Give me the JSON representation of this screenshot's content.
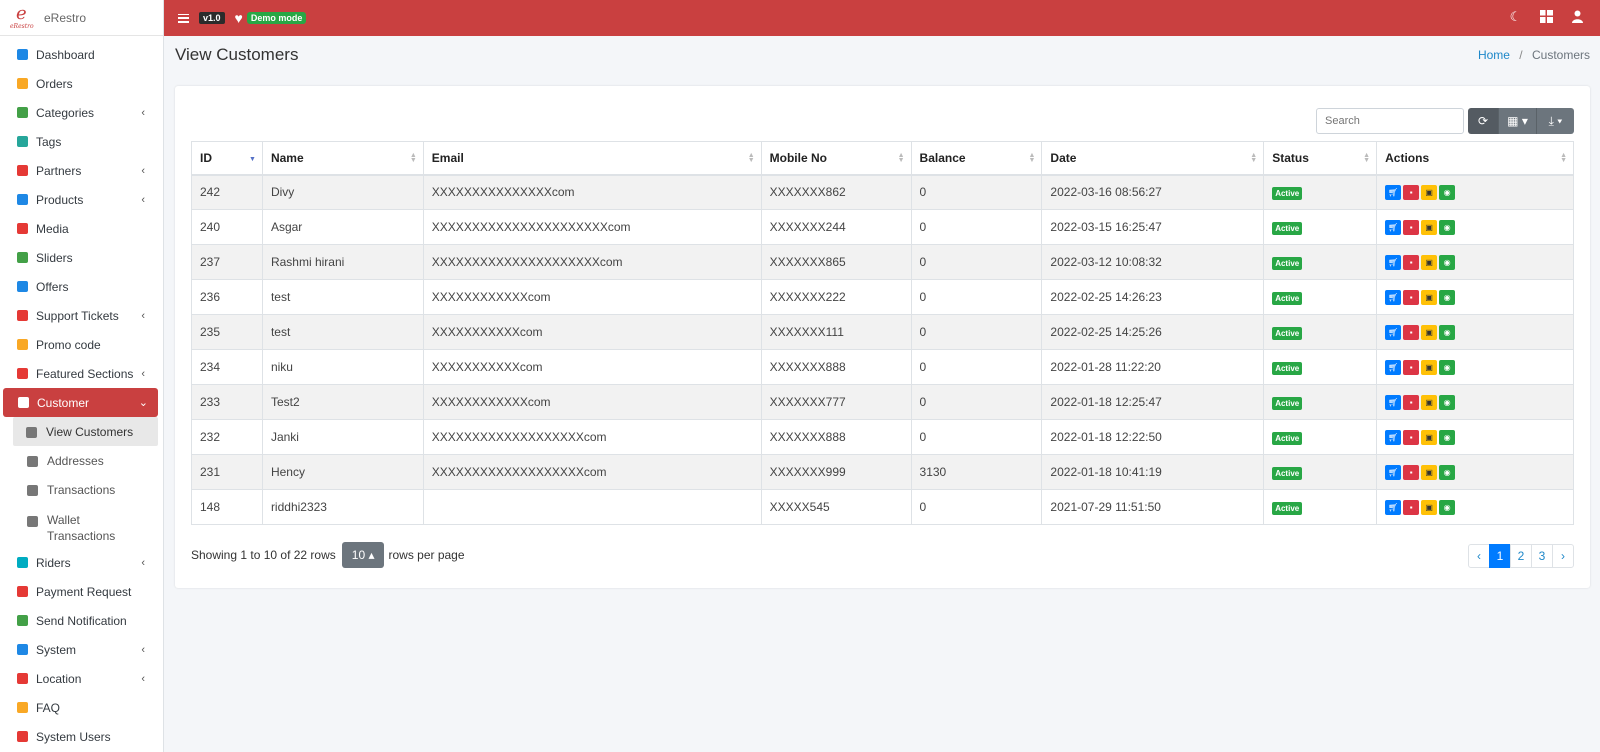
{
  "brand": {
    "name": "eRestro",
    "logo_letter": "e",
    "logo_sub": "eRestro"
  },
  "topbar": {
    "version": "v1.0",
    "demo_label": "Demo mode",
    "color": "#c94040"
  },
  "sidebar": {
    "items": [
      {
        "label": "Dashboard",
        "icon": "dashboard-icon",
        "color": "#1e88e5",
        "chevron": false
      },
      {
        "label": "Orders",
        "icon": "cart-icon",
        "color": "#f9a825",
        "chevron": false
      },
      {
        "label": "Categories",
        "icon": "target-icon",
        "color": "#43a047",
        "chevron": true
      },
      {
        "label": "Tags",
        "icon": "tag-icon",
        "color": "#26a69a",
        "chevron": false
      },
      {
        "label": "Partners",
        "icon": "store-icon",
        "color": "#e53935",
        "chevron": true
      },
      {
        "label": "Products",
        "icon": "cubes-icon",
        "color": "#1e88e5",
        "chevron": true
      },
      {
        "label": "Media",
        "icon": "media-icon",
        "color": "#e53935",
        "chevron": false
      },
      {
        "label": "Sliders",
        "icon": "image-icon",
        "color": "#43a047",
        "chevron": false
      },
      {
        "label": "Offers",
        "icon": "gift-icon",
        "color": "#1e88e5",
        "chevron": false
      },
      {
        "label": "Support Tickets",
        "icon": "ticket-icon",
        "color": "#e53935",
        "chevron": true
      },
      {
        "label": "Promo code",
        "icon": "puzzle-icon",
        "color": "#f9a825",
        "chevron": false
      },
      {
        "label": "Featured Sections",
        "icon": "layers-icon",
        "color": "#e53935",
        "chevron": true
      },
      {
        "label": "Customer",
        "icon": "user-icon",
        "color": "#ffffff",
        "chevron": true,
        "active": true
      }
    ],
    "customer_sub": [
      {
        "label": "View Customers",
        "icon": "users-icon",
        "active": true
      },
      {
        "label": "Addresses",
        "icon": "address-icon"
      },
      {
        "label": "Transactions",
        "icon": "money-icon"
      },
      {
        "label": "Wallet",
        "label2": "Transactions",
        "icon": "wallet-icon"
      }
    ],
    "items_after": [
      {
        "label": "Riders",
        "icon": "id-badge-icon",
        "color": "#00acc1",
        "chevron": true
      },
      {
        "label": "Payment Request",
        "icon": "money-bill-icon",
        "color": "#e53935",
        "chevron": false
      },
      {
        "label": "Send Notification",
        "icon": "paper-plane-icon",
        "color": "#43a047",
        "chevron": false
      },
      {
        "label": "System",
        "icon": "wrench-icon",
        "color": "#1e88e5",
        "chevron": true
      },
      {
        "label": "Location",
        "icon": "map-icon",
        "color": "#e53935",
        "chevron": true
      },
      {
        "label": "FAQ",
        "icon": "question-icon",
        "color": "#f9a825",
        "chevron": false
      },
      {
        "label": "System Users",
        "icon": "user-shield-icon",
        "color": "#e53935",
        "chevron": false
      }
    ]
  },
  "page": {
    "title": "View Customers"
  },
  "breadcrumb": {
    "home": "Home",
    "sep": "/",
    "current": "Customers"
  },
  "toolbar": {
    "search_placeholder": "Search"
  },
  "table": {
    "columns": [
      "ID",
      "Name",
      "Email",
      "Mobile No",
      "Balance",
      "Date",
      "Status",
      "Actions"
    ],
    "rows": [
      {
        "id": "242",
        "name": "Divy",
        "email": "XXXXXXXXXXXXXXXcom",
        "mobile": "XXXXXXX862",
        "balance": "0",
        "date": "2022-03-16 08:56:27",
        "status": "Active"
      },
      {
        "id": "240",
        "name": "Asgar",
        "email": "XXXXXXXXXXXXXXXXXXXXXXcom",
        "mobile": "XXXXXXX244",
        "balance": "0",
        "date": "2022-03-15 16:25:47",
        "status": "Active"
      },
      {
        "id": "237",
        "name": "Rashmi hirani",
        "email": "XXXXXXXXXXXXXXXXXXXXXcom",
        "mobile": "XXXXXXX865",
        "balance": "0",
        "date": "2022-03-12 10:08:32",
        "status": "Active"
      },
      {
        "id": "236",
        "name": "test",
        "email": "XXXXXXXXXXXXcom",
        "mobile": "XXXXXXX222",
        "balance": "0",
        "date": "2022-02-25 14:26:23",
        "status": "Active"
      },
      {
        "id": "235",
        "name": "test",
        "email": "XXXXXXXXXXXcom",
        "mobile": "XXXXXXX111",
        "balance": "0",
        "date": "2022-02-25 14:25:26",
        "status": "Active"
      },
      {
        "id": "234",
        "name": "niku",
        "email": "XXXXXXXXXXXcom",
        "mobile": "XXXXXXX888",
        "balance": "0",
        "date": "2022-01-28 11:22:20",
        "status": "Active"
      },
      {
        "id": "233",
        "name": "Test2",
        "email": "XXXXXXXXXXXXcom",
        "mobile": "XXXXXXX777",
        "balance": "0",
        "date": "2022-01-18 12:25:47",
        "status": "Active"
      },
      {
        "id": "232",
        "name": "Janki",
        "email": "XXXXXXXXXXXXXXXXXXXcom",
        "mobile": "XXXXXXX888",
        "balance": "0",
        "date": "2022-01-18 12:22:50",
        "status": "Active"
      },
      {
        "id": "231",
        "name": "Hency",
        "email": "XXXXXXXXXXXXXXXXXXXcom",
        "mobile": "XXXXXXX999",
        "balance": "3130",
        "date": "2022-01-18 10:41:19",
        "status": "Active"
      },
      {
        "id": "148",
        "name": "riddhi2323",
        "email": "",
        "mobile": "XXXXX545",
        "balance": "0",
        "date": "2021-07-29 11:51:50",
        "status": "Active"
      }
    ]
  },
  "footer": {
    "showing": "Showing 1 to 10 of 22 rows",
    "page_size": "10",
    "rows_per_page": "rows per page"
  },
  "pager": {
    "prev": "‹",
    "pages": [
      "1",
      "2",
      "3"
    ],
    "next": "›",
    "active": "1"
  }
}
